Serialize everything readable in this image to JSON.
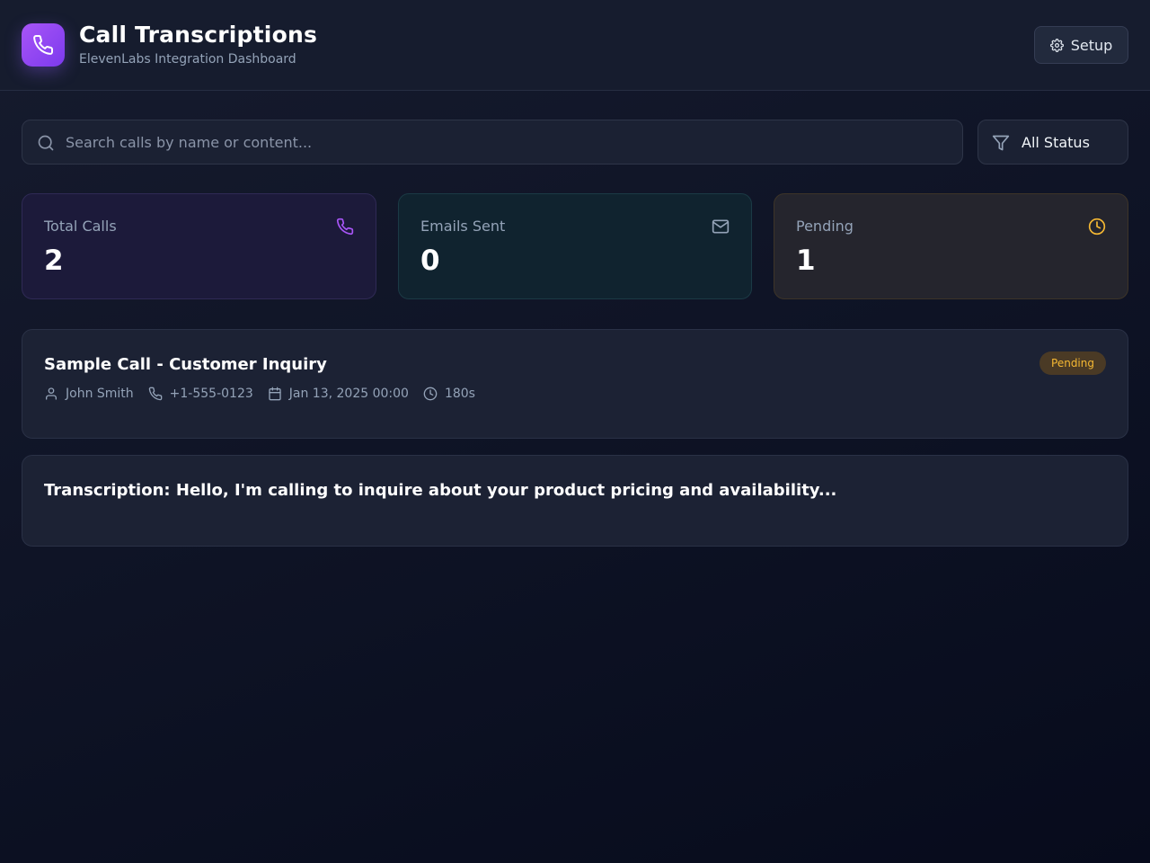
{
  "header": {
    "title": "Call Transcriptions",
    "subtitle": "ElevenLabs Integration Dashboard",
    "setup_label": "Setup",
    "logo_icon": "phone-icon",
    "accent_color": "#8b5cf6"
  },
  "search": {
    "placeholder": "Search calls by name or content...",
    "value": ""
  },
  "filter": {
    "selected": "All Status"
  },
  "stats": [
    {
      "label": "Total Calls",
      "value": "2",
      "icon": "phone-icon",
      "color": "#a855f7"
    },
    {
      "label": "Emails Sent",
      "value": "0",
      "icon": "mail-icon",
      "color": "#94a3b8"
    },
    {
      "label": "Pending",
      "value": "1",
      "icon": "clock-icon",
      "color": "#f5b833"
    }
  ],
  "calls": [
    {
      "title": "Sample Call - Customer Inquiry",
      "status": "Pending",
      "status_color": "#f5b833",
      "caller": "John Smith",
      "phone": "+1-555-0123",
      "date": "Jan 13, 2025 00:00",
      "duration": "180s"
    }
  ],
  "transcription": {
    "text": "Transcription: Hello, I'm calling to inquire about your product pricing and availability..."
  }
}
